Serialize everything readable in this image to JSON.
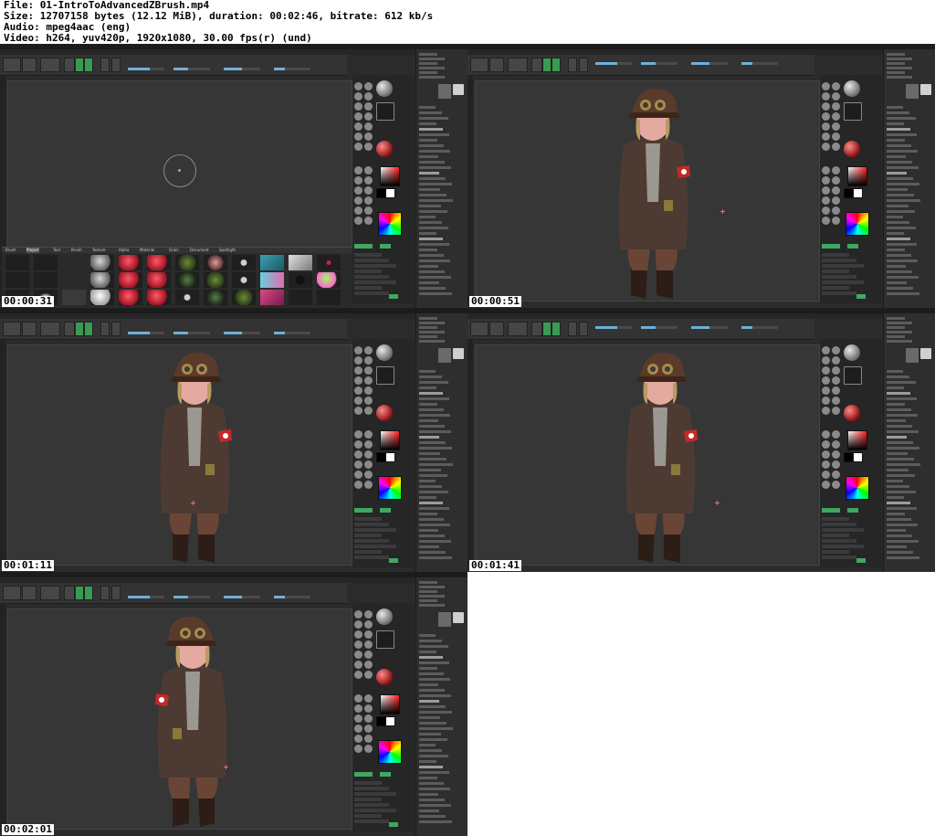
{
  "file_info": {
    "line1": "File: 01-IntroToAdvancedZBrush.mp4",
    "line2": "Size: 12707158 bytes (12.12 MiB), duration: 00:02:46, bitrate: 612 kb/s",
    "line3": "Audio: mpeg4aac (eng)",
    "line4": "Video: h264, yuv420p, 1920x1080, 30.00 fps(r) (und)"
  },
  "frames": [
    {
      "timestamp": "00:00:31",
      "view": "lightbox"
    },
    {
      "timestamp": "00:00:51",
      "view": "side"
    },
    {
      "timestamp": "00:01:11",
      "view": "front"
    },
    {
      "timestamp": "00:01:41",
      "view": "three-quarter"
    },
    {
      "timestamp": "00:02:01",
      "view": "three-quarter-left"
    }
  ],
  "lightbox": {
    "tabs": [
      "Brush",
      "Project",
      "Tool",
      "Brush",
      "Texture",
      "Alpha",
      "Material",
      "Grain",
      "Document",
      "Spotlight"
    ]
  },
  "colors": {
    "zbrush_bg": "#2b2b2b",
    "viewport": "#363636",
    "accent_green": "#3fa860",
    "coat": "#4d3b33",
    "hat": "#5a3a2a",
    "armband": "#c22a2a"
  }
}
